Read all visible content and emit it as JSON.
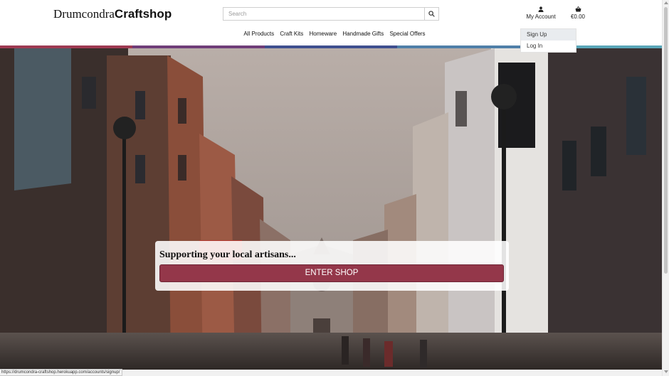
{
  "header": {
    "logo_part1": "Drumcondra",
    "logo_part2": "Craftshop",
    "search_placeholder": "Search",
    "account_label": "My Account",
    "cart_total": "€0.00"
  },
  "nav": {
    "items": [
      {
        "label": "All Products"
      },
      {
        "label": "Craft Kits"
      },
      {
        "label": "Homeware"
      },
      {
        "label": "Handmade Gifts"
      },
      {
        "label": "Special Offers"
      }
    ]
  },
  "account_dropdown": {
    "items": [
      {
        "label": "Sign Up"
      },
      {
        "label": "Log In"
      }
    ]
  },
  "accent_strip_colors": [
    "#9e3a52",
    "#6f3d78",
    "#3f4f8f",
    "#4f7fa8",
    "#5aa6b8"
  ],
  "hero": {
    "tagline": "Supporting your local artisans...",
    "cta_label": "ENTER SHOP",
    "cta_color": "#94374a"
  },
  "status_bar": {
    "url": "https://drumcondra-craftshop.herokuapp.com/accounts/signup/"
  },
  "icons": {
    "search": "search-icon",
    "account": "user-icon",
    "cart": "shopping-basket-icon"
  }
}
